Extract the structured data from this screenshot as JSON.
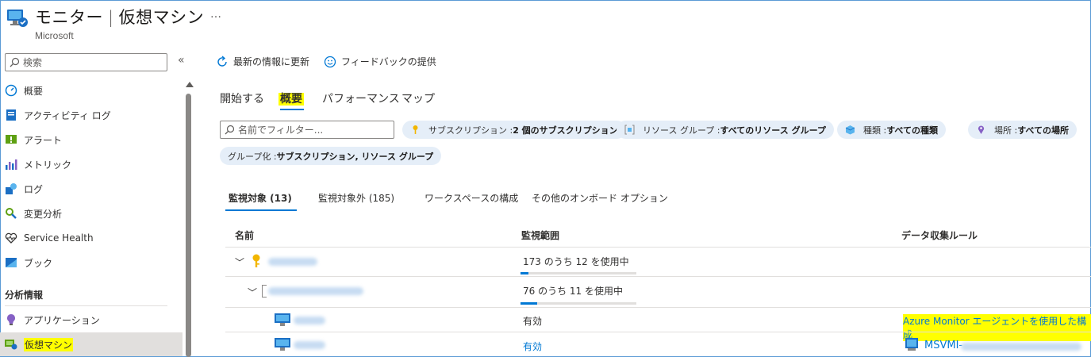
{
  "header": {
    "title": "モニター",
    "separator": "|",
    "page": "仮想マシン",
    "subtitle": "Microsoft",
    "more": "…"
  },
  "sidebar": {
    "search_placeholder": "検索",
    "collapse": "«",
    "items": [
      {
        "label": "概要",
        "icon": "overview-icon"
      },
      {
        "label": "アクティビティ ログ",
        "icon": "activity-log-icon"
      },
      {
        "label": "アラート",
        "icon": "alerts-icon"
      },
      {
        "label": "メトリック",
        "icon": "metrics-icon"
      },
      {
        "label": "ログ",
        "icon": "logs-icon"
      },
      {
        "label": "変更分析",
        "icon": "change-analysis-icon"
      },
      {
        "label": "Service Health",
        "icon": "heart-icon"
      },
      {
        "label": "ブック",
        "icon": "workbooks-icon"
      }
    ],
    "section": "分析情報",
    "insight_items": [
      {
        "label": "アプリケーション",
        "icon": "application-insights-icon"
      },
      {
        "label": "仮想マシン",
        "icon": "virtual-machine-icon",
        "selected": true
      }
    ]
  },
  "toolbar": {
    "refresh": "最新の情報に更新",
    "feedback": "フィードバックの提供"
  },
  "tabs": [
    {
      "label": "開始する"
    },
    {
      "label": "概要",
      "active": true
    },
    {
      "label": "パフォーマンス"
    },
    {
      "label": "マップ"
    }
  ],
  "filter": {
    "placeholder": "名前でフィルター...",
    "pills": [
      {
        "label": "サブスクリプション : ",
        "value": "2 個のサブスクリプション",
        "icon": "key-icon"
      },
      {
        "label": "リソース グループ : ",
        "value": "すべてのリソース グループ",
        "icon": "resource-group-icon"
      },
      {
        "label": "種類 : ",
        "value": "すべての種類",
        "icon": "cube-icon"
      },
      {
        "label": "場所 : ",
        "value": "すべての場所",
        "icon": "location-icon"
      },
      {
        "label": "グループ化 : ",
        "value": "サブスクリプション, リソース グループ",
        "icon": ""
      }
    ]
  },
  "subtabs": [
    {
      "label": "監視対象 (13)",
      "active": true
    },
    {
      "label": "監視対象外 (185)"
    },
    {
      "label": "ワークスペースの構成"
    },
    {
      "label": "その他のオンボード オプション"
    }
  ],
  "grid": {
    "columns": [
      "名前",
      "監視範囲",
      "データ収集ルール"
    ],
    "rows": [
      {
        "coverage": "173 のうち 12 を使用中",
        "fraction": 0.07
      },
      {
        "coverage": "76 のうち 11 を使用中",
        "fraction": 0.145
      },
      {
        "coverage": "有効",
        "dcr": "Azure Monitor エージェントを使用した構成"
      },
      {
        "coverage": "有効",
        "dcr": "MSVMI-"
      }
    ]
  },
  "colors": {
    "accent": "#0078d4",
    "highlight": "#ffff00",
    "pill_bg": "#e5eef8"
  }
}
